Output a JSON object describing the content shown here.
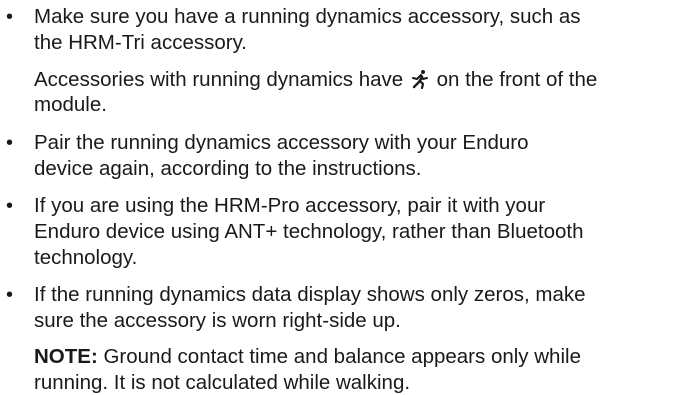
{
  "bullet_symbol": "•",
  "items": [
    {
      "lines": [
        "Make sure you have a running dynamics accessory, such as",
        "the HRM-Tri accessory."
      ],
      "note_before_icon": "Accessories with running dynamics have",
      "icon": "running-figure-icon",
      "note_after_icon": "on the front of the",
      "note_line2": "module."
    },
    {
      "lines": [
        "Pair the running dynamics accessory with your Enduro",
        "device again, according to the instructions."
      ]
    },
    {
      "lines": [
        "If you are using the HRM-Pro accessory, pair it with your",
        "Enduro device using ANT+ technology, rather than Bluetooth",
        "technology."
      ]
    },
    {
      "lines": [
        "If the running dynamics data display shows only zeros, make",
        "sure the accessory is worn right-side up."
      ],
      "note_label": "NOTE:",
      "note_text1": "Ground contact time and balance appears only while",
      "note_text2": "running. It is not calculated while walking."
    }
  ]
}
